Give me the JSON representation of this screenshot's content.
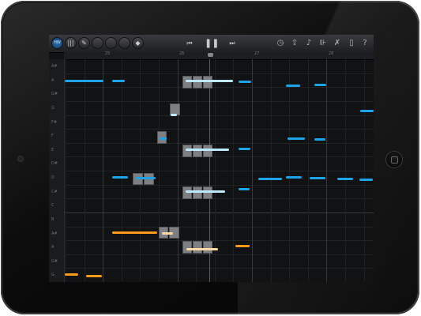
{
  "colors": {
    "blue_note": "#1fa3e8",
    "orange_note": "#ff9a1a",
    "selected_note_blue": "#bfe8ff",
    "selected_note_orange": "#ffd9a3",
    "block": "#7d7f83"
  },
  "toolbar": {
    "left_buttons": [
      {
        "name": "view-mode-button",
        "label": "HW",
        "active": true
      },
      {
        "name": "mixer-button",
        "icon": "mixer-icon",
        "glyph": "|||"
      },
      {
        "name": "pencil-mode-button",
        "icon": "pencil-icon",
        "glyph": "✎"
      },
      {
        "name": "blank-button-1",
        "glyph": ""
      },
      {
        "name": "blank-button-2",
        "glyph": ""
      },
      {
        "name": "blank-button-3",
        "glyph": ""
      },
      {
        "name": "metronome-button",
        "icon": "metronome-icon",
        "glyph": "◆"
      }
    ],
    "transport": [
      {
        "name": "rewind-button",
        "icon": "rewind-icon",
        "glyph": "⏮"
      },
      {
        "name": "pause-button",
        "icon": "pause-icon",
        "glyph": "❚❚"
      },
      {
        "name": "fast-forward-button",
        "icon": "fast-forward-icon",
        "glyph": "⏭"
      }
    ],
    "right_icons": [
      {
        "name": "clock-button",
        "icon": "clock-icon",
        "glyph": "◷"
      },
      {
        "name": "share-button",
        "icon": "share-icon",
        "glyph": "⇪"
      },
      {
        "name": "note-button",
        "icon": "music-note-icon",
        "glyph": "♪"
      },
      {
        "name": "mixer-sliders-button",
        "icon": "sliders-icon",
        "glyph": "⊪"
      },
      {
        "name": "wrench-button",
        "icon": "wrench-icon",
        "glyph": "✗"
      },
      {
        "name": "document-button",
        "icon": "document-icon",
        "glyph": "▯"
      },
      {
        "name": "help-button",
        "icon": "help-icon",
        "glyph": "?"
      }
    ]
  },
  "ruler": {
    "labels": [
      "25",
      "26",
      "27",
      "28"
    ]
  },
  "keys": [
    "A#",
    "A",
    "G#",
    "G",
    "F#",
    "F",
    "E",
    "D#",
    "D",
    "C#",
    "C",
    "B",
    "A#",
    "A",
    "G#",
    "G"
  ]
}
